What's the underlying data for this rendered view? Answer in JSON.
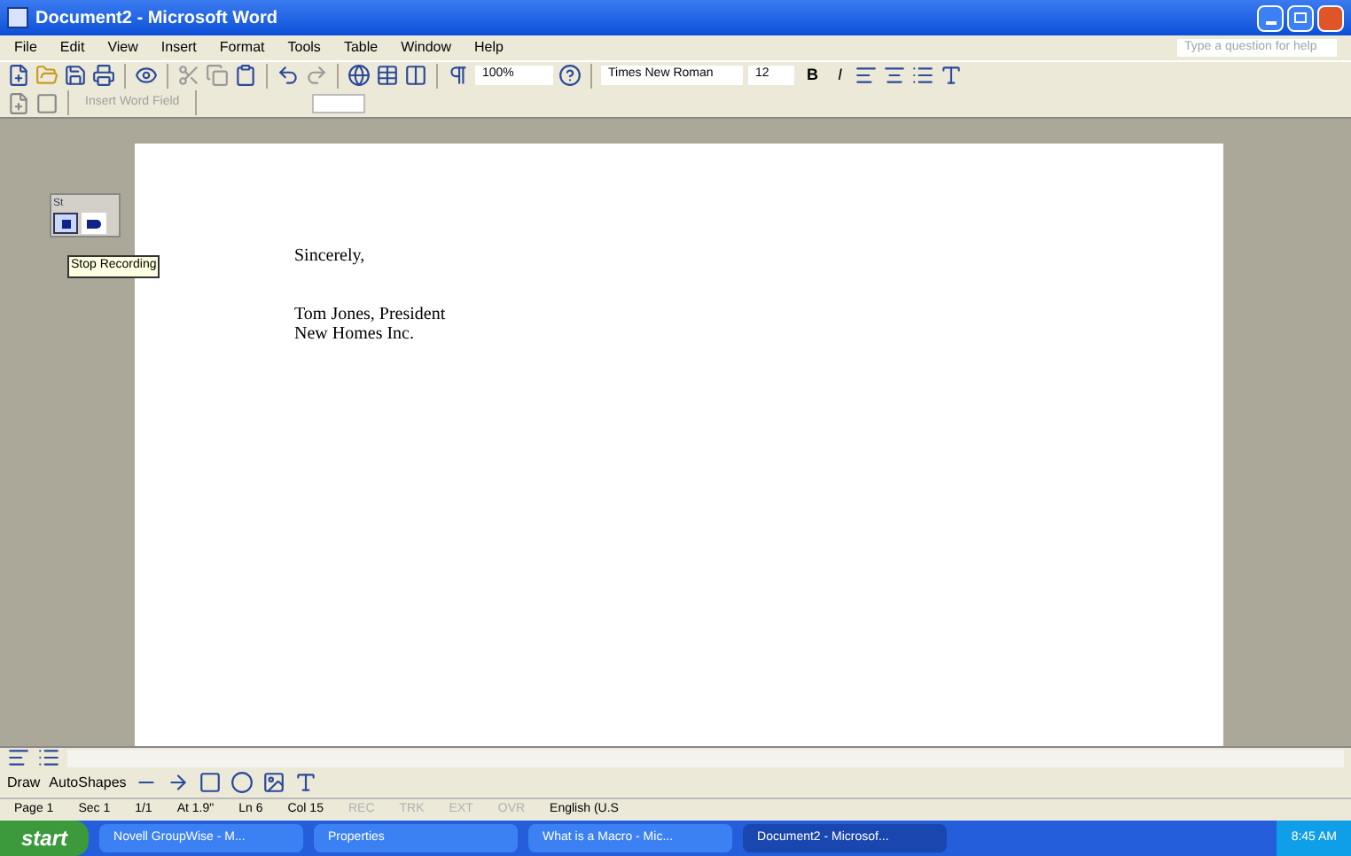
{
  "window": {
    "title": "Document2 - Microsoft Word"
  },
  "menu": [
    "File",
    "Edit",
    "View",
    "Insert",
    "Format",
    "Tools",
    "Table",
    "Window",
    "Help"
  ],
  "help_box": {
    "placeholder": "Type a question for help"
  },
  "formatting": {
    "zoom": "100%",
    "font": "Times New Roman",
    "size": "12",
    "bold": "B",
    "italic": "I"
  },
  "mail_merge": {
    "field_button": "Insert Word Field"
  },
  "recorder": {
    "title": "St",
    "tooltip": "Stop Recording"
  },
  "document": {
    "paragraphs": [
      {
        "kind": "line",
        "text": "Sincerely,"
      },
      {
        "kind": "gap"
      },
      {
        "kind": "line",
        "text": "Tom Jones, President"
      },
      {
        "kind": "line",
        "text": "New Homes Inc."
      }
    ]
  },
  "drawing": {
    "draw": "Draw",
    "autoshapes": "AutoShapes"
  },
  "status_bar": [
    {
      "text": "Page 1",
      "disabled": false
    },
    {
      "text": "Sec 1",
      "disabled": false
    },
    {
      "text": "1/1",
      "disabled": false
    },
    {
      "text": "At 1.9\"",
      "disabled": false
    },
    {
      "text": "Ln 6",
      "disabled": false
    },
    {
      "text": "Col 15",
      "disabled": false
    },
    {
      "text": "REC",
      "disabled": true
    },
    {
      "text": "TRK",
      "disabled": true
    },
    {
      "text": "EXT",
      "disabled": true
    },
    {
      "text": "OVR",
      "disabled": true
    },
    {
      "text": "English (U.S",
      "disabled": false
    }
  ],
  "taskbar": {
    "start": "start",
    "time": "8:45 AM",
    "items": [
      {
        "label": "Novell GroupWise - M...",
        "selected": false
      },
      {
        "label": "Properties",
        "selected": false
      },
      {
        "label": "What is a Macro - Mic...",
        "selected": false
      },
      {
        "label": "Document2 - Microsof...",
        "selected": true
      }
    ]
  }
}
